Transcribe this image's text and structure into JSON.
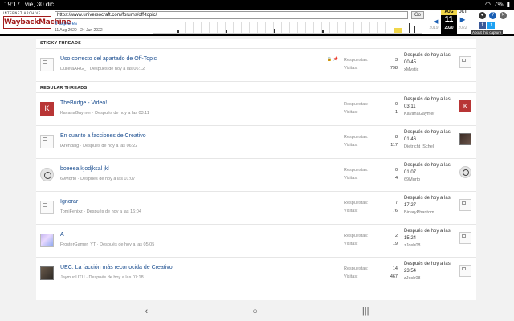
{
  "status_bar": {
    "time": "19:17",
    "date": "vie, 30 dic.",
    "battery": "7%"
  },
  "wayback": {
    "logo_top": "INTERNET ARCHIVE",
    "logo_main": "WaybackMachine",
    "url": "https://www.universocraft.com/forums/off-topic/",
    "go_label": "Go",
    "captures": "8 captures",
    "range": "11 Aug 2020 - 24 Jun 2022",
    "prev": {
      "month": "",
      "year": "2019"
    },
    "current": {
      "month": "AUG",
      "day": "11",
      "year": "2020"
    },
    "next": {
      "month": "OCT",
      "year": "2022"
    },
    "about": "About this capture"
  },
  "forum": {
    "sticky_header": "STICKY THREADS",
    "regular_header": "REGULAR THREADS",
    "replies_label": "Respuestas:",
    "views_label": "Visitas:",
    "sticky": [
      {
        "title": "Uso correcto del apartado de Off-Topic",
        "author": "iJulietaARG_",
        "time": "Después de hoy a las 06:12",
        "replies": "3",
        "views": "798",
        "last_time": "Después de hoy a las 00:45",
        "last_user": "xMystic__",
        "avatar": "img",
        "last_avatar": "img"
      }
    ],
    "threads": [
      {
        "title": "TheBridge - Video!",
        "author": "KavanaGaymer",
        "time": "Después de hoy a las 03:11",
        "replies": "0",
        "views": "1",
        "last_time": "Después de hoy a las 03:11",
        "last_user": "KavanaGaymer",
        "avatar": "k",
        "last_avatar": "k",
        "avatar_letter": "K"
      },
      {
        "title": "En cuanto a facciones de Creativo",
        "author": "iArendalg",
        "time": "Después de hoy a las 06:22",
        "replies": "8",
        "views": "117",
        "last_time": "Después de hoy a las 01:46",
        "last_user": "Dietricht_Scheli",
        "avatar": "img",
        "last_avatar": "dark"
      },
      {
        "title": "boeeea kjodjksal jkl",
        "author": "69Mqrto",
        "time": "Después de hoy a las 01:07",
        "replies": "0",
        "views": "4",
        "last_time": "Después de hoy a las 01:07",
        "last_user": "69Mqrto",
        "avatar": "ban",
        "last_avatar": "ban"
      },
      {
        "title": "Ignorar",
        "author": "TomiFenixz",
        "time": "Después de hoy a las 16:04",
        "replies": "7",
        "views": "76",
        "last_time": "Después de hoy a las 17:27",
        "last_user": "BinaryPhantom",
        "avatar": "img",
        "last_avatar": "img"
      },
      {
        "title": "A",
        "author": "FrosterGamer_YT",
        "time": "Después de hoy a las 05:05",
        "replies": "2",
        "views": "19",
        "last_time": "Después de hoy a las 15:24",
        "last_user": "zJosh08",
        "avatar": "pix",
        "last_avatar": "img"
      },
      {
        "title": "UEC: La facción más reconocida de Creativo",
        "author": "JaymunUTU",
        "time": "Después de hoy a las 07:18",
        "replies": "14",
        "views": "467",
        "last_time": "Después de hoy a las 23:54",
        "last_user": "zJosh08",
        "avatar": "photo",
        "last_avatar": "img"
      }
    ]
  },
  "nav": {
    "back": "‹",
    "home": "○",
    "recents": "|||"
  }
}
